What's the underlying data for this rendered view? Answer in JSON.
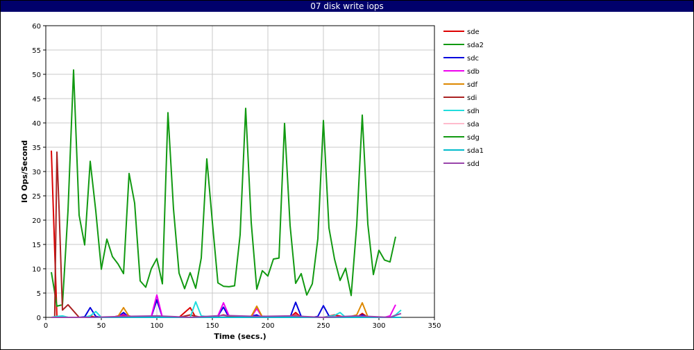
{
  "window": {
    "title": "07 disk write iops"
  },
  "chart_data": {
    "type": "line",
    "title": "07 disk write iops",
    "xlabel": "Time (secs.)",
    "ylabel": "IO Ops/Second",
    "xlim": [
      0,
      350
    ],
    "ylim": [
      0,
      60
    ],
    "x_ticks": [
      0,
      50,
      100,
      150,
      200,
      250,
      300,
      350
    ],
    "y_ticks": [
      0,
      5,
      10,
      15,
      20,
      25,
      30,
      35,
      40,
      45,
      50,
      55,
      60
    ],
    "grid": true,
    "legend_position": "right",
    "series": [
      {
        "name": "sde",
        "color": "#dd0000",
        "x": [
          5,
          10,
          15,
          20,
          25,
          30,
          35,
          40,
          45,
          50,
          60,
          70,
          80,
          90,
          100,
          110,
          120,
          130,
          135,
          140,
          150,
          160,
          170,
          180,
          190,
          200,
          210,
          220,
          225,
          230,
          240,
          250,
          260,
          270,
          280,
          285,
          290,
          300,
          310,
          315
        ],
        "y": [
          34.3,
          0.2,
          0.2,
          0,
          0,
          0,
          0,
          0.3,
          0,
          0,
          0,
          0.6,
          0,
          0,
          0.3,
          0,
          0,
          2,
          0,
          0,
          0,
          0.5,
          0,
          0,
          0.3,
          0,
          0,
          0,
          1,
          0,
          0,
          0,
          0.5,
          0,
          0,
          0.8,
          0,
          0,
          0,
          0
        ]
      },
      {
        "name": "sda2",
        "color": "#119911",
        "x": [
          5,
          10,
          15,
          20,
          25,
          30,
          35,
          40,
          45,
          50,
          55,
          60,
          65,
          70,
          75,
          80,
          85,
          90,
          95,
          100,
          105,
          110,
          115,
          120,
          125,
          130,
          135,
          140,
          145,
          150,
          155,
          160,
          165,
          170,
          175,
          180,
          185,
          190,
          195,
          200,
          205,
          210,
          215,
          220,
          225,
          230,
          235,
          240,
          245,
          250,
          255,
          260,
          265,
          270,
          275,
          280,
          285,
          290,
          295,
          300,
          305,
          310,
          315
        ],
        "y": [
          9.3,
          2.3,
          2.6,
          22,
          50.9,
          21,
          14.9,
          32.1,
          21.9,
          9.9,
          16.1,
          12.5,
          11,
          9,
          29.6,
          23.5,
          7.5,
          6.2,
          10,
          12.1,
          6.9,
          42.1,
          22.3,
          9.1,
          5.9,
          9.2,
          6,
          12.2,
          32.6,
          19.6,
          7.1,
          6.4,
          6.3,
          6.5,
          17,
          43,
          19.5,
          5.8,
          9.6,
          8.5,
          12,
          12.2,
          39.9,
          18.9,
          7,
          9,
          4.6,
          6.9,
          16.2,
          40.5,
          18.4,
          12,
          7.6,
          10.1,
          4.5,
          19,
          41.6,
          19.2,
          8.8,
          13.8,
          11.8,
          11.4,
          16.6
        ]
      },
      {
        "name": "sdc",
        "color": "#0000dd",
        "x": [
          5,
          20,
          30,
          35,
          40,
          45,
          50,
          60,
          65,
          70,
          75,
          80,
          90,
          95,
          100,
          105,
          110,
          120,
          130,
          140,
          150,
          155,
          160,
          165,
          170,
          180,
          190,
          195,
          200,
          210,
          220,
          225,
          230,
          240,
          245,
          250,
          255,
          260,
          270,
          280,
          285,
          290,
          300,
          310,
          315
        ],
        "y": [
          0,
          0,
          0,
          0.1,
          2,
          0.2,
          0,
          0,
          0.1,
          1,
          0,
          0,
          0,
          0.1,
          3.6,
          0,
          0,
          0,
          0,
          0,
          0,
          0.3,
          2.1,
          0,
          0,
          0,
          0.5,
          0,
          0,
          0,
          0,
          3.1,
          0.2,
          0,
          0.2,
          2.4,
          0.3,
          0,
          0,
          0,
          0.5,
          0,
          0,
          0,
          0
        ]
      },
      {
        "name": "sdb",
        "color": "#ee00ee",
        "x": [
          5,
          20,
          40,
          50,
          60,
          70,
          80,
          90,
          95,
          100,
          105,
          110,
          120,
          130,
          140,
          150,
          155,
          160,
          165,
          170,
          180,
          185,
          190,
          195,
          200,
          210,
          220,
          225,
          230,
          240,
          250,
          260,
          270,
          280,
          290,
          300,
          305,
          310,
          315
        ],
        "y": [
          0,
          0,
          0,
          0,
          0,
          0.5,
          0,
          0,
          0.2,
          4.6,
          0,
          0,
          0,
          0,
          0,
          0,
          0.3,
          3,
          0.3,
          0,
          0,
          0.1,
          1.8,
          0,
          0,
          0,
          0,
          0.6,
          0,
          0,
          0,
          0,
          0,
          0,
          0,
          0,
          0,
          0.3,
          2.6
        ]
      },
      {
        "name": "sdf",
        "color": "#dd8800",
        "x": [
          5,
          20,
          40,
          50,
          60,
          65,
          70,
          75,
          80,
          90,
          100,
          110,
          120,
          130,
          140,
          150,
          160,
          170,
          180,
          185,
          190,
          195,
          200,
          210,
          220,
          225,
          230,
          240,
          250,
          260,
          270,
          275,
          280,
          285,
          290,
          300,
          310,
          320
        ],
        "y": [
          0,
          0,
          0,
          0,
          0,
          0.2,
          2,
          0.2,
          0,
          0,
          0.3,
          0,
          0,
          0,
          0,
          0,
          0,
          0,
          0,
          0.2,
          2.3,
          0.1,
          0,
          0,
          0,
          0.5,
          0,
          0,
          0,
          0,
          0,
          0.2,
          0.5,
          3,
          0.1,
          0,
          0,
          0
        ]
      },
      {
        "name": "sdi",
        "color": "#aa2222",
        "x": [
          5,
          8,
          10,
          12,
          15,
          20,
          30,
          40,
          50,
          60,
          70,
          80,
          90,
          100,
          110,
          120,
          130,
          140,
          150,
          160,
          170,
          180,
          190,
          200,
          210,
          220,
          230,
          240,
          250,
          260,
          270,
          280,
          290,
          300,
          310,
          320
        ],
        "y": [
          0,
          0,
          34,
          22,
          1.5,
          2.6,
          0,
          0,
          0,
          0,
          0.3,
          0,
          0,
          0.2,
          0,
          0,
          0.5,
          0,
          0,
          0,
          0.2,
          0,
          0,
          0,
          0,
          0,
          0,
          0,
          0,
          0,
          0,
          0,
          0,
          0,
          0,
          0
        ]
      },
      {
        "name": "sdh",
        "color": "#22dddd",
        "x": [
          5,
          10,
          15,
          20,
          30,
          35,
          40,
          45,
          50,
          60,
          70,
          80,
          90,
          100,
          110,
          120,
          130,
          135,
          140,
          150,
          160,
          170,
          180,
          190,
          200,
          210,
          220,
          230,
          240,
          250,
          260,
          265,
          270,
          280,
          290,
          300,
          310,
          315,
          320
        ],
        "y": [
          0,
          0.2,
          0.3,
          0,
          0,
          0,
          0.3,
          1.2,
          0,
          0,
          0,
          0,
          0,
          0,
          0,
          0,
          0,
          3.2,
          0.3,
          0,
          0,
          0,
          0,
          0,
          0,
          0,
          0,
          0,
          0,
          0,
          0.4,
          1,
          0,
          0,
          0,
          0,
          0,
          0.5,
          1.5
        ]
      },
      {
        "name": "sda",
        "color": "#ffbbcc",
        "x": [
          5,
          40,
          80,
          100,
          120,
          160,
          200,
          240,
          280,
          320
        ],
        "y": [
          0,
          0,
          0,
          0,
          0,
          0,
          0,
          0,
          0,
          0
        ]
      },
      {
        "name": "sdg",
        "color": "#119911",
        "x": [
          5,
          40,
          80,
          120,
          160,
          200,
          240,
          280,
          320
        ],
        "y": [
          0,
          0,
          0,
          0,
          0,
          0,
          0,
          0,
          0
        ]
      },
      {
        "name": "sda1",
        "color": "#00bbcc",
        "x": [
          5,
          40,
          80,
          120,
          160,
          200,
          240,
          280,
          320
        ],
        "y": [
          0,
          0,
          0,
          0,
          0,
          0,
          0,
          0,
          0
        ]
      },
      {
        "name": "sdd",
        "color": "#9944aa",
        "x": [
          5,
          40,
          70,
          100,
          130,
          160,
          190,
          220,
          250,
          280,
          310,
          320
        ],
        "y": [
          0,
          0,
          0.2,
          0.3,
          0,
          0.4,
          0.2,
          0.3,
          0,
          0.3,
          0,
          0.8
        ]
      }
    ]
  }
}
